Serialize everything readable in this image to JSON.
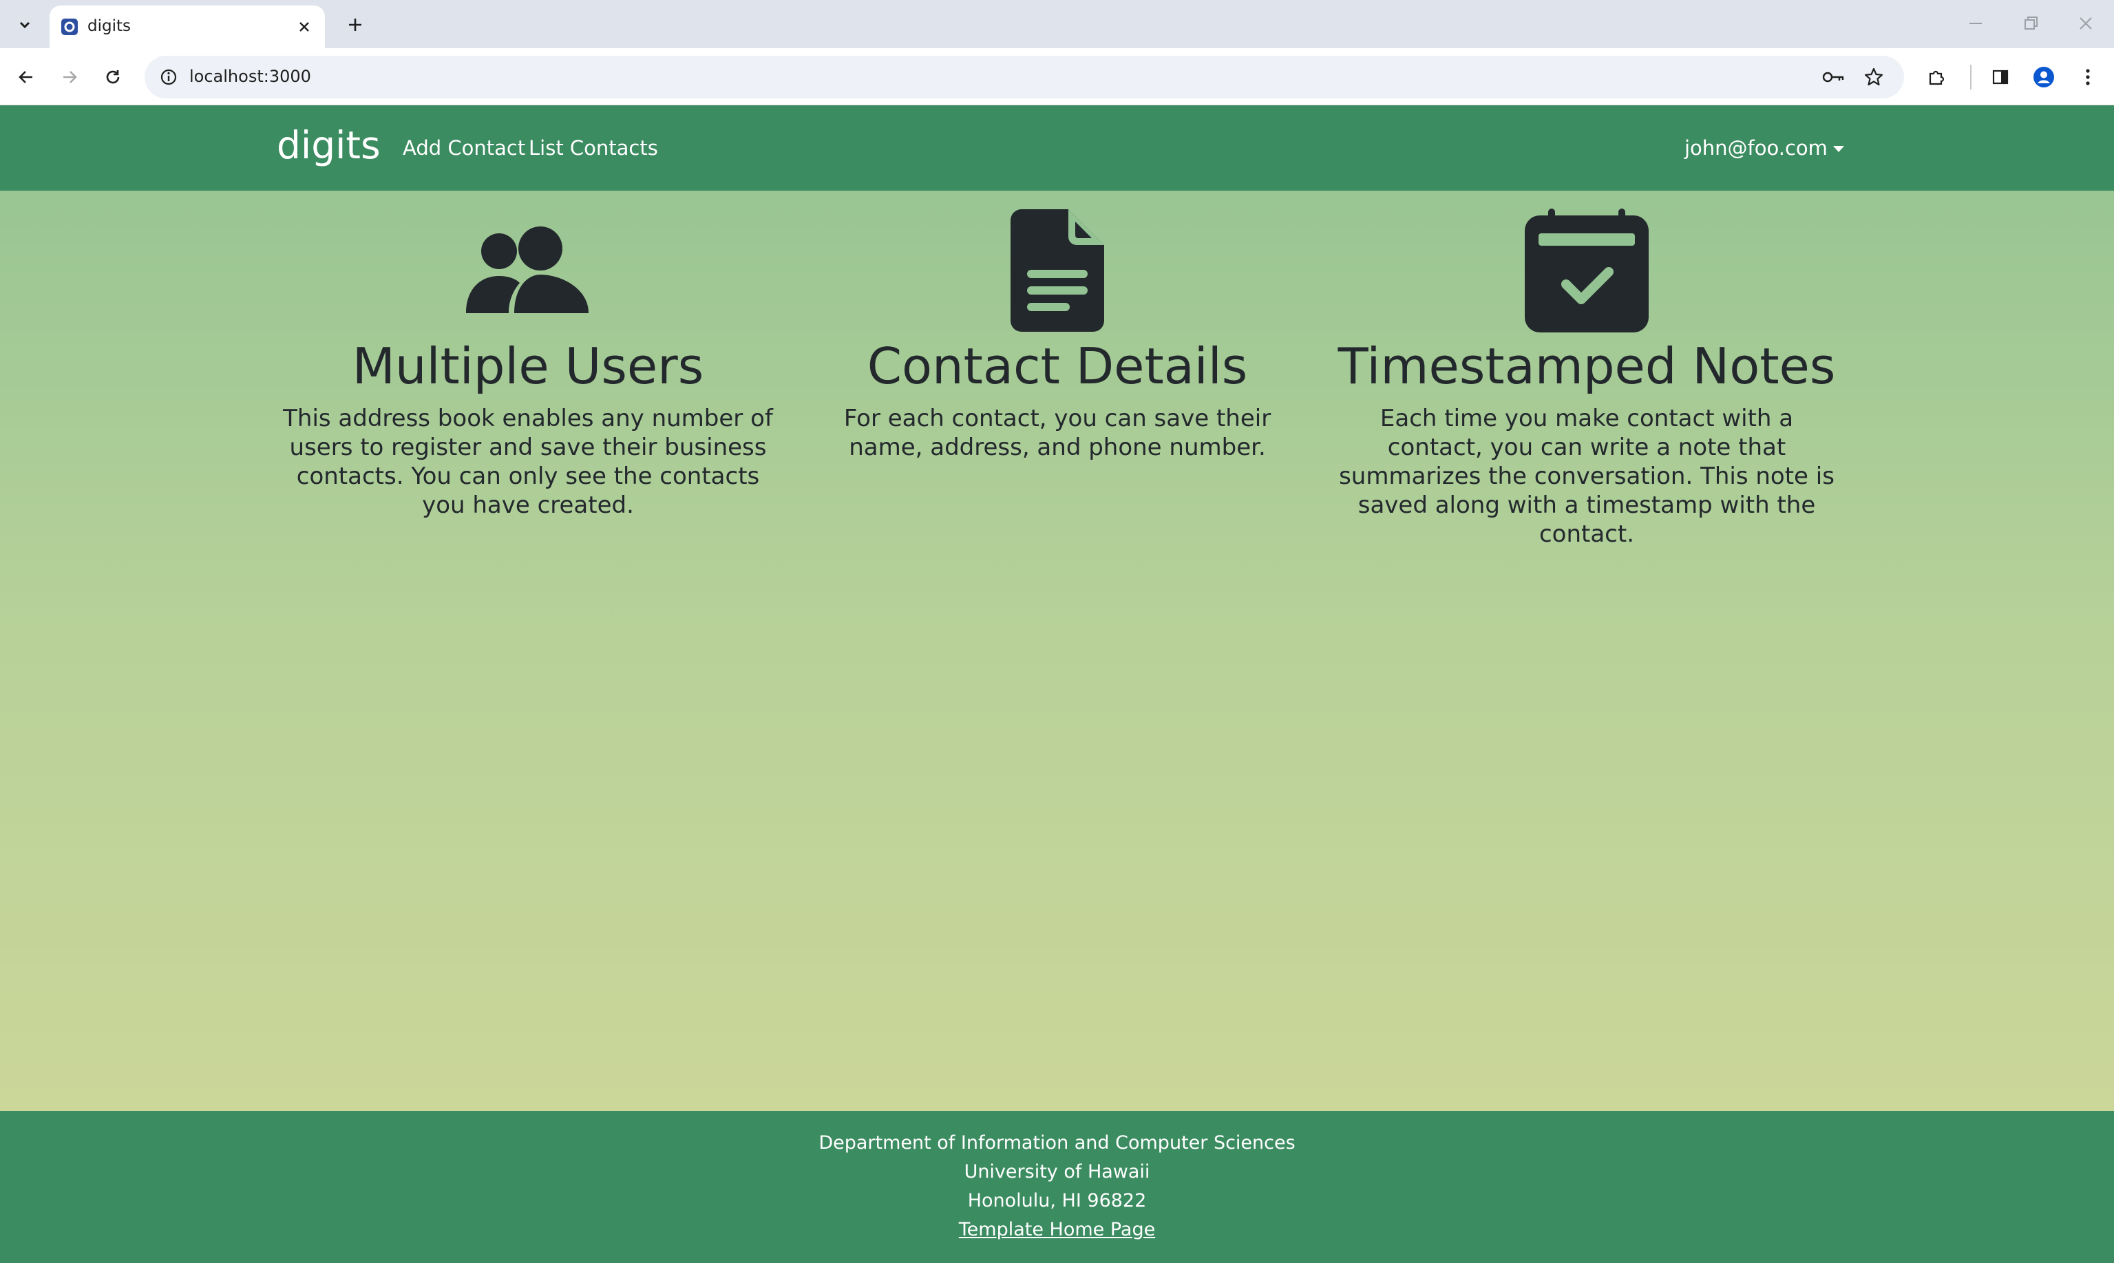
{
  "browser": {
    "tab_title": "digits",
    "url": "localhost:3000"
  },
  "navbar": {
    "brand": "digits",
    "links": [
      "Add Contact",
      "List Contacts"
    ],
    "user": "john@foo.com"
  },
  "features": [
    {
      "icon": "users-icon",
      "title": "Multiple Users",
      "text": "This address book enables any number of users to register and save their business contacts. You can only see the contacts you have created."
    },
    {
      "icon": "document-icon",
      "title": "Contact Details",
      "text": "For each contact, you can save their name, address, and phone number."
    },
    {
      "icon": "calendar-check-icon",
      "title": "Timestamped Notes",
      "text": "Each time you make contact with a contact, you can write a note that summarizes the conversation. This note is saved along with a timestamp with the contact."
    }
  ],
  "footer": {
    "lines": [
      "Department of Information and Computer Sciences",
      "University of Hawaii",
      "Honolulu, HI 96822"
    ],
    "link": "Template Home Page"
  },
  "colors": {
    "navbar": "#3b8c61",
    "gradient_top": "#93c392",
    "gradient_bottom": "#d2d899",
    "icon": "#23282d"
  }
}
